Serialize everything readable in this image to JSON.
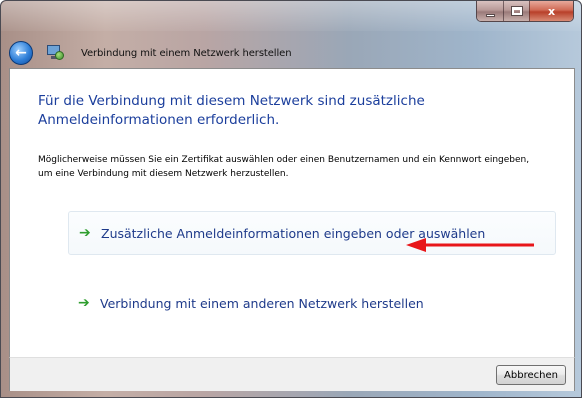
{
  "window": {
    "title": "Verbindung mit einem Netzwerk herstellen",
    "caption_buttons": [
      "minimize",
      "maximize",
      "close"
    ],
    "close_glyph": "x"
  },
  "nav": {
    "back_icon": "back-arrow-icon",
    "network_icon": "network-icon"
  },
  "content": {
    "heading": "Für die Verbindung mit diesem Netzwerk sind zusätzliche Anmeldeinformationen erforderlich.",
    "description": "Möglicherweise müssen Sie ein Zertifikat auswählen oder einen Benutzernamen und ein Kennwort eingeben, um eine Verbindung mit diesem Netzwerk herzustellen.",
    "options": [
      {
        "label": "Zusätzliche Anmeldeinformationen eingeben oder auswählen",
        "icon": "green-arrow-icon"
      },
      {
        "label": "Verbindung mit einem anderen Netzwerk herstellen",
        "icon": "green-arrow-icon"
      }
    ]
  },
  "footer": {
    "cancel_label": "Abbrechen"
  },
  "colors": {
    "heading": "#1b3e9c",
    "option_text": "#1e3a8a",
    "option_arrow": "#2f9e2f",
    "annotation_arrow": "#e8161a"
  }
}
